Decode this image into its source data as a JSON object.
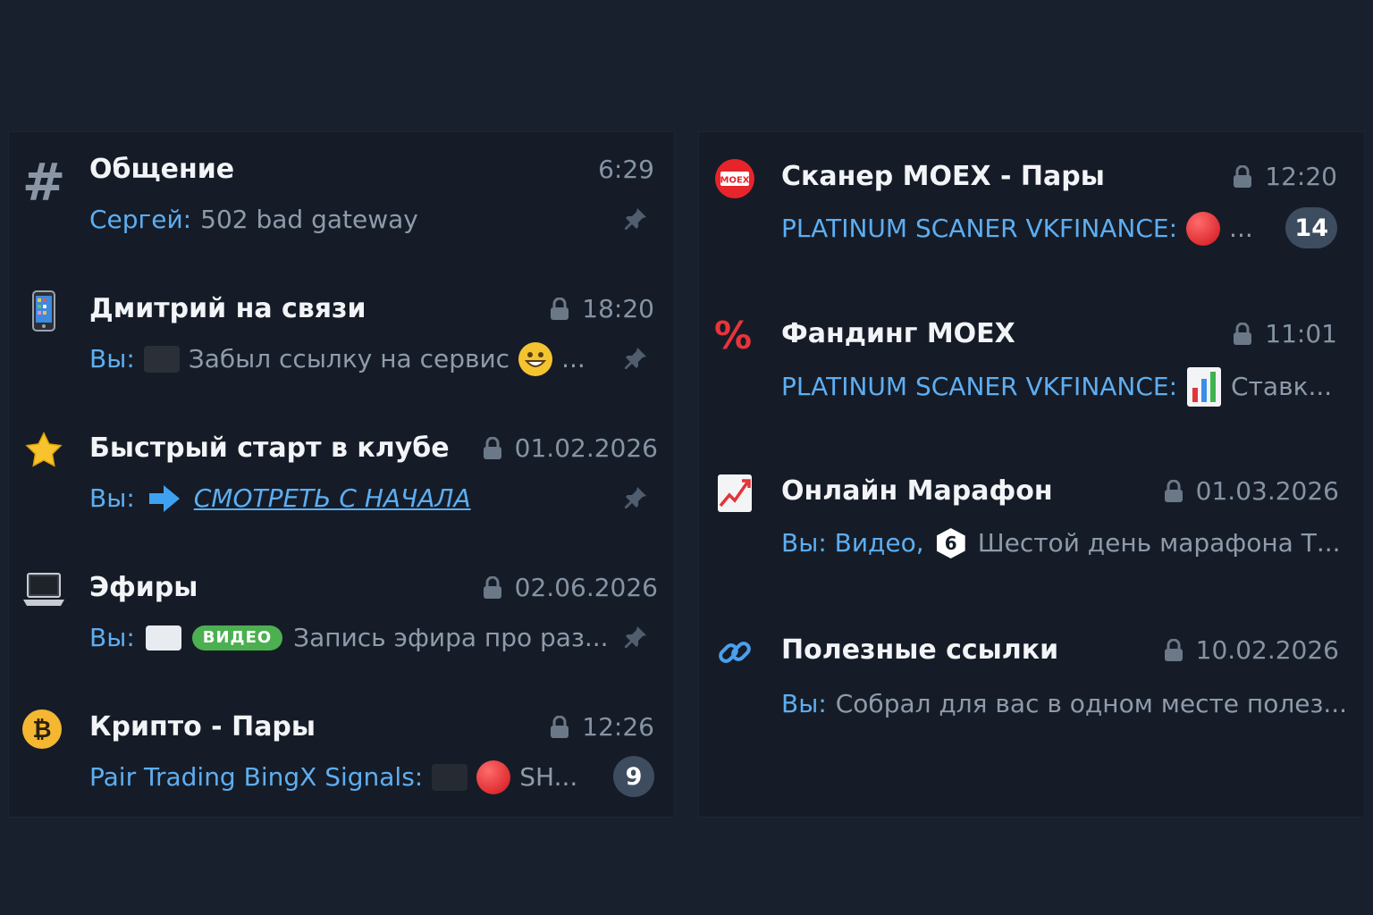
{
  "left_chats": [
    {
      "icon": "hash-icon",
      "title": "Общение",
      "time": "6:29",
      "locked": false,
      "sender": "Сергей:",
      "text": "502 bad gateway",
      "pinned": true
    },
    {
      "icon": "phone-icon",
      "title": "Дмитрий на связи",
      "time": "18:20",
      "locked": true,
      "sender": "Вы:",
      "text": "Забыл ссылку на сервис",
      "ellipsis": "...",
      "pinned": true
    },
    {
      "icon": "star-icon",
      "title": "Быстрый старт в клубе",
      "time": "01.02.2026",
      "locked": true,
      "sender": "Вы:",
      "link_text": "СМОТРЕТЬ С НАЧАЛА",
      "pinned": true
    },
    {
      "icon": "laptop-icon",
      "title": "Эфиры",
      "time": "02.06.2026",
      "locked": true,
      "sender": "Вы:",
      "tag": "ВИДЕО",
      "text": "Запись эфира про раз...",
      "pinned": true
    },
    {
      "icon": "bitcoin-icon",
      "title": "Крипто - Пары",
      "time": "12:26",
      "locked": true,
      "sender": "Pair Trading BingX Signals:",
      "text": "SH...",
      "unread": "9"
    }
  ],
  "right_chats": [
    {
      "icon": "moex-logo-icon",
      "logo_text": "MOEX",
      "title": "Сканер MOEX - Пары",
      "time": "12:20",
      "locked": true,
      "sender": "PLATINUM SCANER VKFINANCE:",
      "text": "...",
      "unread": "14"
    },
    {
      "icon": "percent-icon",
      "title": "Фандинг MOEX",
      "time": "11:01",
      "locked": true,
      "sender": "PLATINUM SCANER VKFINANCE:",
      "text": "Ставк..."
    },
    {
      "icon": "chart-up-icon",
      "title": "Онлайн Марафон",
      "time": "01.03.2026",
      "locked": true,
      "sender": "Вы: Видео,",
      "number_badge": "6",
      "text": "Шестой день марафона  Т..."
    },
    {
      "icon": "link-icon",
      "title": "Полезные ссылки",
      "time": "10.02.2026",
      "locked": true,
      "sender": "Вы:",
      "text": "Собрал для вас в одном месте полез..."
    }
  ],
  "colors": {
    "background": "#18202d",
    "panel": "#151c27",
    "accent": "#5eaef2",
    "badge": "#3e4c60",
    "video_tag": "#4caf50"
  }
}
